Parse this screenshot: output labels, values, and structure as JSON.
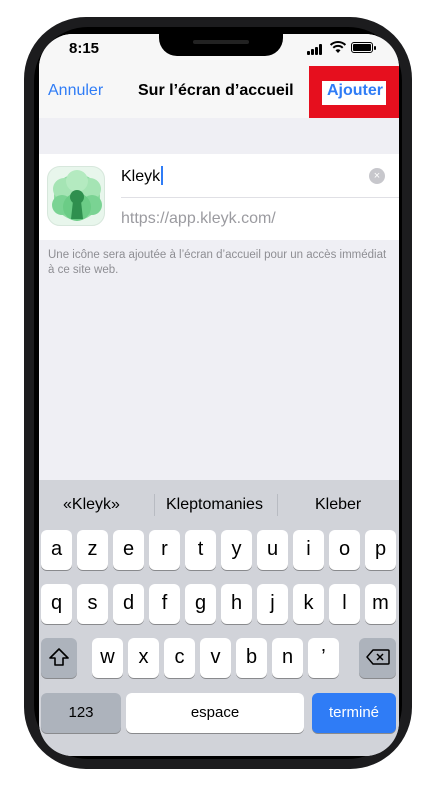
{
  "status": {
    "time": "8:15"
  },
  "nav": {
    "cancel": "Annuler",
    "title": "Sur l’écran d’accueil",
    "add": "Ajouter"
  },
  "form": {
    "name": "Kleyk",
    "url": "https://app.kleyk.com/",
    "clear_symbol": "×"
  },
  "hint": "Une icône sera ajoutée à l’écran d’accueil pour un accès immédiat à ce site web.",
  "suggestions": [
    "«Kleyk»",
    "Kleptomanies",
    "Kleber"
  ],
  "keyboard": {
    "row1": [
      "a",
      "z",
      "e",
      "r",
      "t",
      "y",
      "u",
      "i",
      "o",
      "p"
    ],
    "row2": [
      "q",
      "s",
      "d",
      "f",
      "g",
      "h",
      "j",
      "k",
      "l",
      "m"
    ],
    "row3": [
      "w",
      "x",
      "c",
      "v",
      "b",
      "n",
      "’"
    ],
    "numbers": "123",
    "space": "espace",
    "done": "terminé"
  },
  "colors": {
    "accent": "#2f7cf6",
    "highlight": "#e60f1e",
    "icon_green": "#5cc47a"
  }
}
